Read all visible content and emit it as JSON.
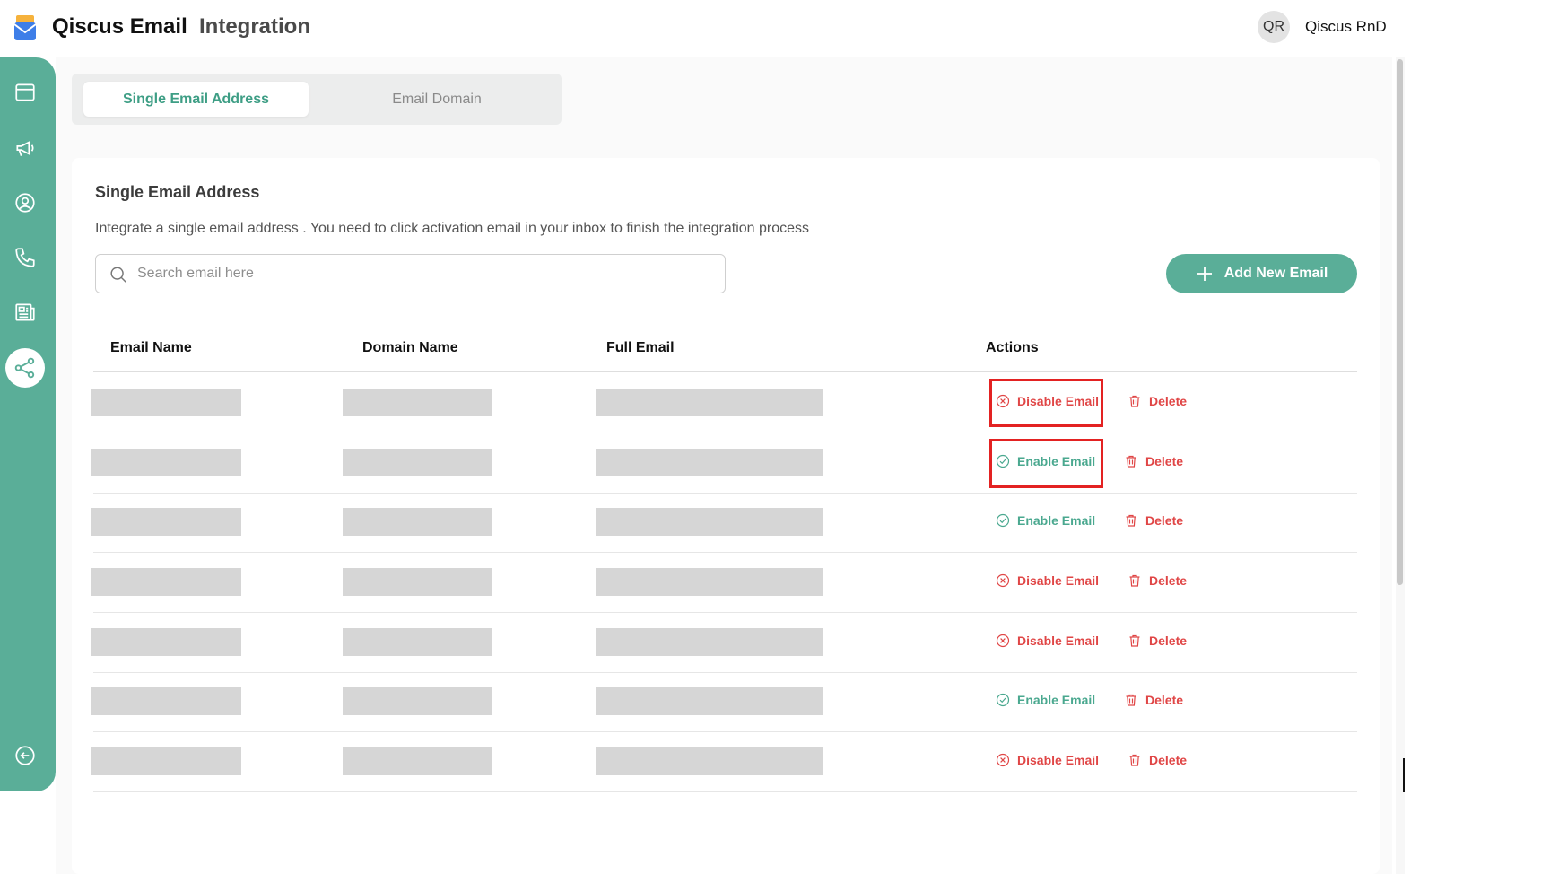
{
  "header": {
    "app_title": "Qiscus Email",
    "page_title": "Integration",
    "avatar_initials": "QR",
    "user_name": "Qiscus RnD"
  },
  "sidebar": {
    "items": [
      {
        "icon": "window-icon"
      },
      {
        "icon": "megaphone-icon"
      },
      {
        "icon": "user-circle-icon"
      },
      {
        "icon": "phone-icon"
      },
      {
        "icon": "newspaper-icon"
      },
      {
        "icon": "share-icon",
        "active": true
      },
      {
        "icon": "collapse-arrow-icon"
      }
    ]
  },
  "tabs": [
    {
      "label": "Single Email Address",
      "active": true
    },
    {
      "label": "Email Domain",
      "active": false
    }
  ],
  "card": {
    "title": "Single Email Address",
    "description": "Integrate a single email address . You need to click activation email in your inbox to finish the integration process",
    "search_placeholder": "Search email here",
    "add_button_label": "Add New Email"
  },
  "table": {
    "columns": [
      "Email Name",
      "Domain Name",
      "Full Email",
      "Actions"
    ],
    "delete_label": "Delete",
    "rows": [
      {
        "toggle": "Disable Email",
        "status": "disable"
      },
      {
        "toggle": "Enable Email",
        "status": "enable"
      },
      {
        "toggle": "Enable Email",
        "status": "enable"
      },
      {
        "toggle": "Disable Email",
        "status": "disable"
      },
      {
        "toggle": "Disable Email",
        "status": "disable"
      },
      {
        "toggle": "Enable Email",
        "status": "enable"
      },
      {
        "toggle": "Disable Email",
        "status": "disable"
      }
    ]
  },
  "colors": {
    "accent": "#5aae98",
    "accent_text": "#3e9e85",
    "danger": "#e04646",
    "highlight": "#e32222"
  }
}
